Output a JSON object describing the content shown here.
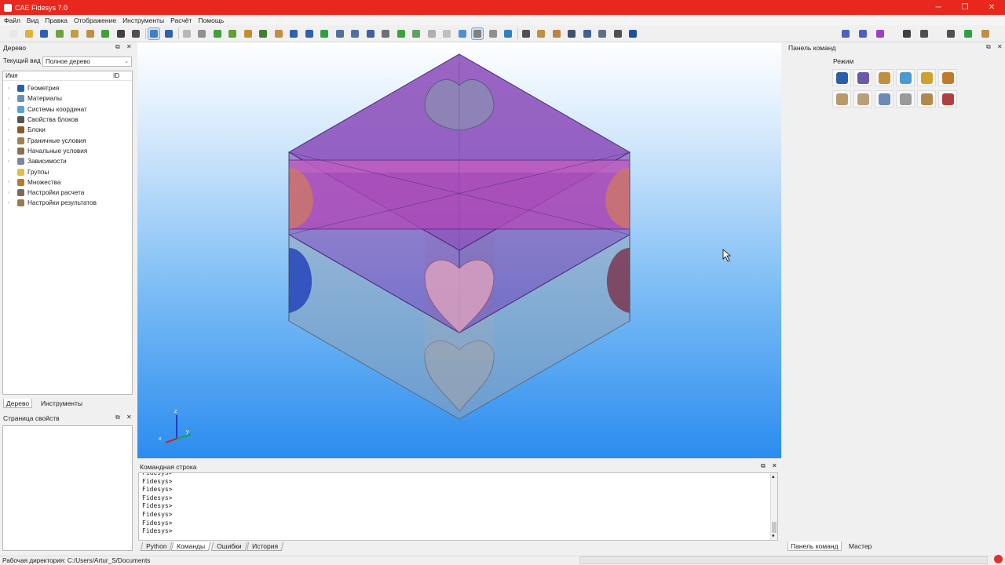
{
  "window": {
    "title": "CAE Fidesys 7.0",
    "controls": [
      "─",
      "❐",
      "✕"
    ]
  },
  "menu": [
    "Файл",
    "Вид",
    "Правка",
    "Отображение",
    "Инструменты",
    "Расчёт",
    "Помощь"
  ],
  "toolbar": {
    "left_icons": [
      "new-file-icon",
      "open-folder-icon",
      "save-icon",
      "save-as-icon",
      "edit-icon",
      "script-icon",
      "run-script-icon",
      "record-icon",
      "settings-icon",
      "select-icon",
      "undo-icon",
      "view-wire-icon",
      "view-shaded-icon",
      "view-solid-icon",
      "view-hidden-icon",
      "mesh-icon",
      "volume-icon",
      "pick-icon",
      "grid-icon",
      "fit-icon",
      "rotate-icon",
      "zoom-in-icon",
      "zoom-out-icon",
      "perspective-icon",
      "frame-icon",
      "box-icon",
      "cube-icon",
      "cube-gray-icon",
      "cube-mesh-icon",
      "sphere-icon",
      "window-select-icon",
      "highlight-icon",
      "axis-icon",
      "probe-icon",
      "clip-icon",
      "tool-icon",
      "view-dark-icon",
      "view-blue-icon",
      "view-gray-icon",
      "curve-icon",
      "dot-icon"
    ],
    "right_icons": [
      "crosshair-icon",
      "minus-icon",
      "rectangle-icon",
      "up-icon",
      "align-icon",
      "split-icon",
      "play-icon",
      "chart-icon"
    ]
  },
  "tree_panel": {
    "title": "Дерево",
    "view_label": "Текущий вид",
    "view_value": "Полное дерево",
    "col_name": "Имя",
    "col_id": "ID",
    "items": [
      {
        "label": "Геометрия",
        "icon": "geometry-icon",
        "color": "#2b5ea8",
        "exp": true
      },
      {
        "label": "Материалы",
        "icon": "materials-icon",
        "color": "#6a8fb8",
        "exp": true
      },
      {
        "label": "Системы координат",
        "icon": "coordinate-system-icon",
        "color": "#5aa0d0",
        "exp": true
      },
      {
        "label": "Свойства блоков",
        "icon": "block-properties-icon",
        "color": "#555555",
        "exp": true
      },
      {
        "label": "Блоки",
        "icon": "blocks-icon",
        "color": "#8a5a2b",
        "exp": true
      },
      {
        "label": "Граничные условия",
        "icon": "boundary-conditions-icon",
        "color": "#a08050",
        "exp": true
      },
      {
        "label": "Начальные условия",
        "icon": "initial-conditions-icon",
        "color": "#8a7050",
        "exp": true
      },
      {
        "label": "Зависимости",
        "icon": "dependencies-icon",
        "color": "#7a8a9a",
        "exp": true
      },
      {
        "label": "Группы",
        "icon": "groups-icon",
        "color": "#e0c040",
        "exp": false
      },
      {
        "label": "Множества",
        "icon": "sets-icon",
        "color": "#b87a2b",
        "exp": true
      },
      {
        "label": "Настройки расчета",
        "icon": "calc-settings-icon",
        "color": "#7a6a5a",
        "exp": true
      },
      {
        "label": "Настройки результатов",
        "icon": "results-settings-icon",
        "color": "#9a7a4a",
        "exp": true
      }
    ],
    "tabs": [
      "Дерево",
      "Инструменты"
    ]
  },
  "props_panel": {
    "title": "Страница свойств"
  },
  "viewport": {
    "axes_labels": [
      "x",
      "y",
      "z"
    ]
  },
  "command_panel": {
    "title": "Панель команд",
    "mode_label": "Режим",
    "buttons": [
      {
        "icon": "geometry-mode-icon",
        "color": "#2b5ea8"
      },
      {
        "icon": "mesh-mode-icon",
        "color": "#6a5aa8"
      },
      {
        "icon": "tools-mode-icon",
        "color": "#c09040"
      },
      {
        "icon": "coord-mode-icon",
        "color": "#4a9ad0"
      },
      {
        "icon": "block-mode-icon",
        "color": "#d0a030"
      },
      {
        "icon": "sets-mode-icon",
        "color": "#c07a2b"
      },
      {
        "icon": "bc-mode-icon",
        "color": "#b89a6a"
      },
      {
        "icon": "initial-mode-icon",
        "color": "#b8a07a"
      },
      {
        "icon": "graph-mode-icon",
        "color": "#6a8ab8"
      },
      {
        "icon": "calc-mode-icon",
        "color": "#9a9a9a"
      },
      {
        "icon": "result-mode-icon",
        "color": "#b08a4a"
      },
      {
        "icon": "analysis-mode-icon",
        "color": "#b04040"
      }
    ],
    "tabs": [
      "Панель команд",
      "Мастер"
    ]
  },
  "command_line": {
    "title": "Командная строка",
    "lines": [
      "Fidesys>",
      "Fidesys>",
      "Fidesys>",
      "Fidesys>",
      "Fidesys>",
      "Fidesys>",
      "Fidesys>",
      "Fidesys>"
    ],
    "tabs": [
      "Python",
      "Команды",
      "Ошибки",
      "История"
    ],
    "active_tab": "Команды"
  },
  "status": {
    "text": "Рабочая директория: C:/Users/Artur_S/Documents"
  }
}
